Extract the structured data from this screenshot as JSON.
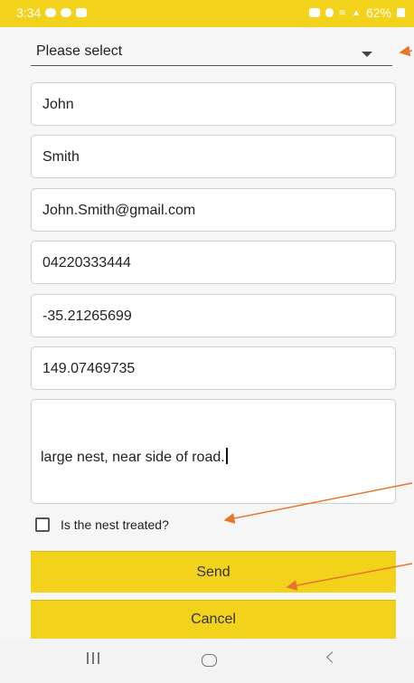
{
  "status_bar": {
    "time": "3:34",
    "battery": "62%",
    "icons_left": [
      "notification-icon",
      "chat-icon",
      "gallery-icon"
    ],
    "icons_right": [
      "alarm-icon",
      "location-icon",
      "wifi-icon",
      "signal-icon"
    ]
  },
  "form": {
    "dropdown": {
      "selected": "Please select"
    },
    "fields": {
      "first_name": "John",
      "last_name": "Smith",
      "email": "John.Smith@gmail.com",
      "phone": "04220333444",
      "latitude": "-35.21265699",
      "longitude": "149.07469735"
    },
    "notes": "large nest, near side of road.",
    "treated_checkbox": {
      "label": "Is the nest treated?",
      "checked": false
    }
  },
  "buttons": {
    "send": "Send",
    "cancel": "Cancel"
  },
  "nav_bar": {
    "icons": [
      "recent-apps-icon",
      "home-icon",
      "back-icon"
    ]
  },
  "colors": {
    "accent": "#f3d21c",
    "annotation_arrow": "#e8762c"
  }
}
